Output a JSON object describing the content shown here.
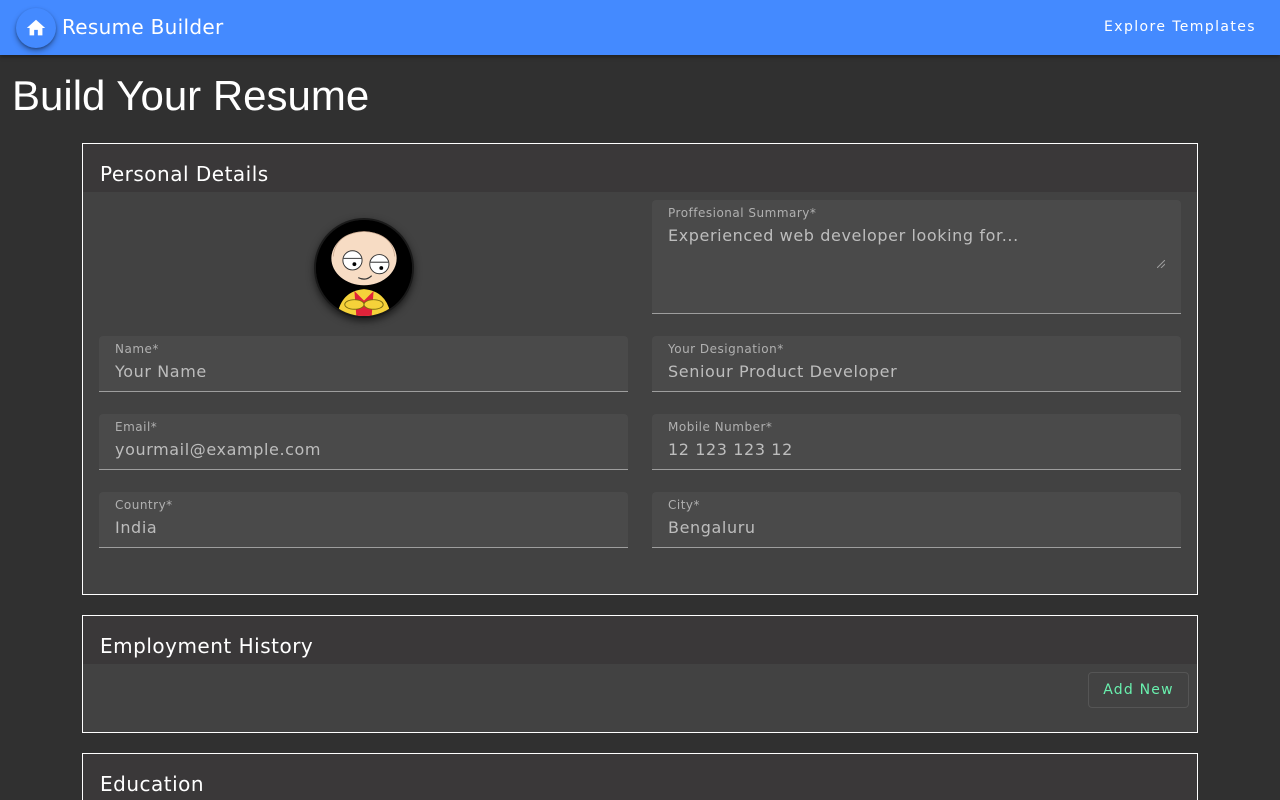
{
  "appbar": {
    "title": "Resume Builder",
    "explore_label": "Explore Templates",
    "home_icon": "home-icon",
    "color": "#448aff"
  },
  "page": {
    "title": "Build Your Resume"
  },
  "personal": {
    "title": "Personal Details",
    "avatar_icon": "cartoon-character-avatar",
    "fields": {
      "summary": {
        "label": "Proffesional Summary*",
        "value": "Experienced web developer looking for..."
      },
      "name": {
        "label": "Name*",
        "value": "Your Name"
      },
      "designation": {
        "label": "Your Designation*",
        "value": "Seniour Product Developer"
      },
      "email": {
        "label": "Email*",
        "value": "yourmail@example.com"
      },
      "mobile": {
        "label": "Mobile Number*",
        "value": "12 123 123 12"
      },
      "country": {
        "label": "Country*",
        "value": "India"
      },
      "city": {
        "label": "City*",
        "value": "Bengaluru"
      }
    }
  },
  "employment": {
    "title": "Employment History",
    "add_label": "Add New",
    "accent": "#69f0ae"
  },
  "education": {
    "title": "Education"
  }
}
